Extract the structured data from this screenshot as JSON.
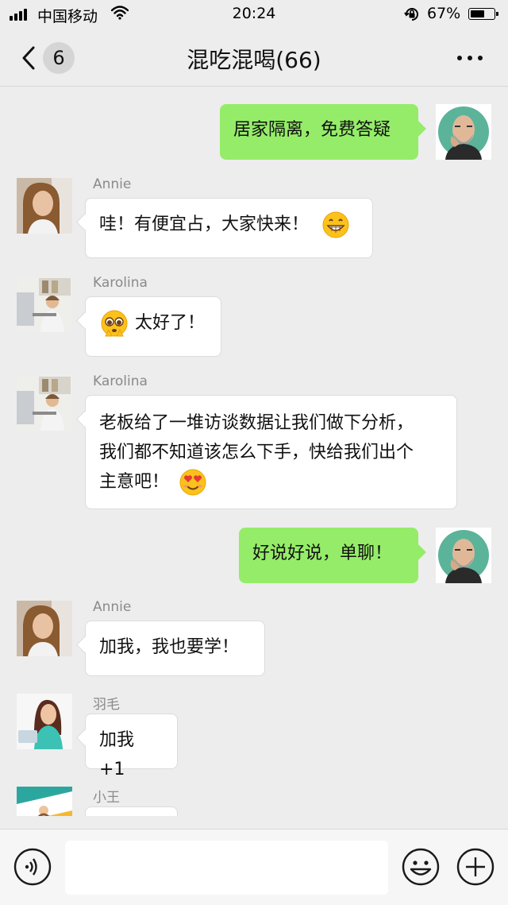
{
  "status_bar": {
    "carrier": "中国移动",
    "time": "20:24",
    "battery_percent": "67%",
    "battery_level": 0.67,
    "icons": [
      "signal-icon",
      "wifi-icon",
      "orientation-lock-icon",
      "battery-icon"
    ]
  },
  "nav": {
    "unread_count": "6",
    "title": "混吃混喝(66)",
    "icons": [
      "chevron-left-icon",
      "more-icon"
    ]
  },
  "messages": [
    {
      "sender": "",
      "direction": "out",
      "text": "居家隔离，免费答疑",
      "avatar": "bald-man-avatar"
    },
    {
      "sender": "Annie",
      "direction": "in",
      "text": "哇！有便宜占，大家快来！",
      "emoji_after": "grinning-face-emoji",
      "avatar": "annie-avatar"
    },
    {
      "sender": "Karolina",
      "direction": "in",
      "text": "太好了！",
      "emoji_before": "pleading-face-emoji",
      "avatar": "karolina-avatar"
    },
    {
      "sender": "Karolina",
      "direction": "in",
      "lines": [
        "老板给了一堆访谈数据让我们做下分析，",
        "我们都不知道该怎么下手，快给我们出个",
        "主意吧！"
      ],
      "emoji_after": "heart-eyes-emoji",
      "avatar": "karolina-avatar"
    },
    {
      "sender": "",
      "direction": "out",
      "text": "好说好说，单聊！",
      "avatar": "bald-man-avatar"
    },
    {
      "sender": "Annie",
      "direction": "in",
      "text": "加我，我也要学！",
      "avatar": "annie-avatar"
    },
    {
      "sender": "羽毛",
      "direction": "in",
      "text": "加我 +1",
      "avatar": "yumao-avatar"
    },
    {
      "sender": "小王",
      "direction": "in",
      "text": "",
      "avatar": "xiaowang-avatar"
    }
  ],
  "input_bar": {
    "placeholder": "",
    "icons": [
      "voice-icon",
      "emoji-icon",
      "plus-icon"
    ]
  },
  "colors": {
    "background": "#ededed",
    "outgoing_bubble": "#95ec69",
    "incoming_bubble": "#ffffff",
    "sender_name": "#8a8a8a",
    "avatar_teal": "#5bb39a"
  }
}
